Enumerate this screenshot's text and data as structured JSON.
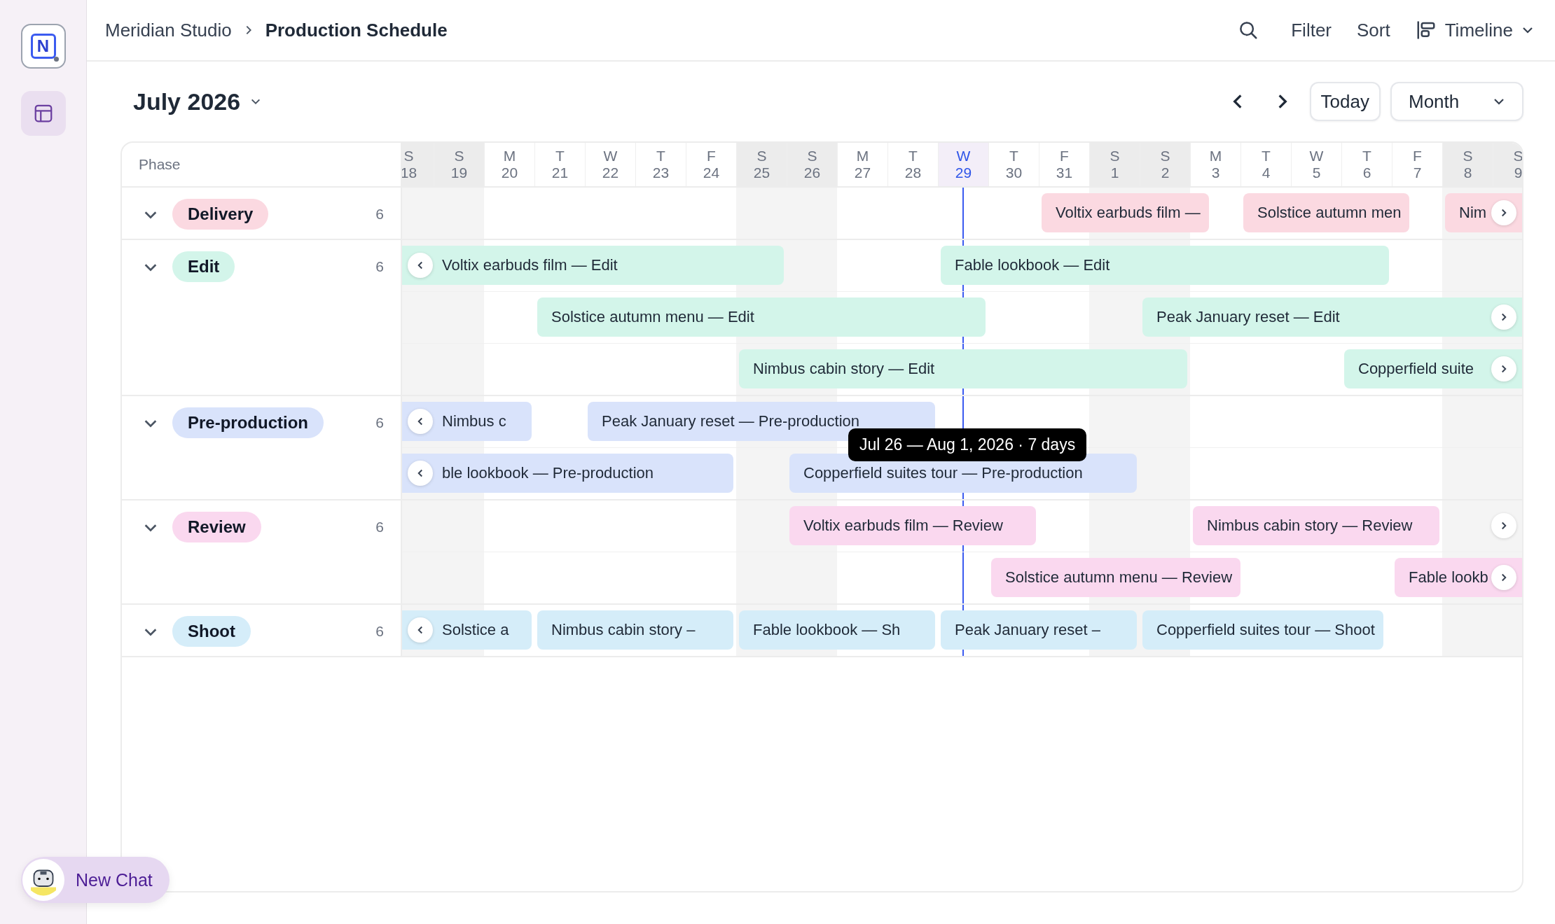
{
  "sidebar": {
    "logo": "N",
    "items": [
      {
        "selected": true
      }
    ]
  },
  "breadcrumb": [
    "Meridian Studio",
    "Production Schedule"
  ],
  "header_actions": [
    "Filter",
    "Sort"
  ],
  "view_menu": "Timeline",
  "calendar": {
    "month": "July 2026",
    "today_button": "Today",
    "range": "Month"
  },
  "timeline": {
    "column_header": "Phase",
    "days": [
      {
        "weekday": "S",
        "date": "18",
        "weekend": true,
        "today": false
      },
      {
        "weekday": "S",
        "date": "19",
        "weekend": true,
        "today": false
      },
      {
        "weekday": "M",
        "date": "20",
        "weekend": false,
        "today": false
      },
      {
        "weekday": "T",
        "date": "21",
        "weekend": false,
        "today": false
      },
      {
        "weekday": "W",
        "date": "22",
        "weekend": false,
        "today": false
      },
      {
        "weekday": "T",
        "date": "23",
        "weekend": false,
        "today": false
      },
      {
        "weekday": "F",
        "date": "24",
        "weekend": false,
        "today": false
      },
      {
        "weekday": "S",
        "date": "25",
        "weekend": true,
        "today": false
      },
      {
        "weekday": "S",
        "date": "26",
        "weekend": true,
        "today": false
      },
      {
        "weekday": "M",
        "date": "27",
        "weekend": false,
        "today": false
      },
      {
        "weekday": "T",
        "date": "28",
        "weekend": false,
        "today": false
      },
      {
        "weekday": "W",
        "date": "29",
        "weekend": false,
        "today": true
      },
      {
        "weekday": "T",
        "date": "30",
        "weekend": false,
        "today": false
      },
      {
        "weekday": "F",
        "date": "31",
        "weekend": false,
        "today": false
      },
      {
        "weekday": "S",
        "date": "1",
        "weekend": true,
        "today": false
      },
      {
        "weekday": "S",
        "date": "2",
        "weekend": true,
        "today": false
      },
      {
        "weekday": "M",
        "date": "3",
        "weekend": false,
        "today": false
      },
      {
        "weekday": "T",
        "date": "4",
        "weekend": false,
        "today": false
      },
      {
        "weekday": "W",
        "date": "5",
        "weekend": false,
        "today": false
      },
      {
        "weekday": "T",
        "date": "6",
        "weekend": false,
        "today": false
      },
      {
        "weekday": "F",
        "date": "7",
        "weekend": false,
        "today": false
      },
      {
        "weekday": "S",
        "date": "8",
        "weekend": true,
        "today": false
      },
      {
        "weekday": "S",
        "date": "9",
        "weekend": true,
        "today": false
      }
    ],
    "groups": [
      {
        "name": "Delivery",
        "color": "#fbd9e1",
        "count": "6",
        "expanded": true,
        "lanes": [
          {
            "more_before": false,
            "more_after": true,
            "bars": [
              {
                "label": "Voltix earbuds film —"
              },
              {
                "label": "Solstice autumn men"
              },
              {
                "label": "Nim"
              }
            ]
          }
        ]
      },
      {
        "name": "Edit",
        "color": "#d3f5ea",
        "count": "6",
        "expanded": true,
        "lanes": [
          {
            "more_before": true,
            "more_after": false,
            "bars": [
              {
                "label": "Voltix earbuds film — Edit"
              },
              {
                "label": "Fable lookbook — Edit"
              }
            ]
          },
          {
            "more_before": false,
            "more_after": true,
            "bars": [
              {
                "label": "Solstice autumn menu — Edit"
              },
              {
                "label": "Peak January reset — Edit"
              }
            ]
          },
          {
            "more_before": false,
            "more_after": true,
            "bars": [
              {
                "label": "Nimbus cabin story — Edit"
              },
              {
                "label": "Copperfield suite"
              }
            ]
          }
        ]
      },
      {
        "name": "Pre-production",
        "color": "#d9e3fb",
        "count": "6",
        "expanded": true,
        "lanes": [
          {
            "more_before": true,
            "more_after": false,
            "bars": [
              {
                "label": "Nimbus c"
              },
              {
                "label": "Peak January reset — Pre-production"
              }
            ]
          },
          {
            "more_before": true,
            "more_after": false,
            "bars": [
              {
                "label": "ble lookbook — Pre-production"
              },
              {
                "label": "Copperfield suites tour — Pre-production",
                "tooltip": "Jul 26 — Aug 1, 2026 · 7 days"
              }
            ]
          }
        ]
      },
      {
        "name": "Review",
        "color": "#fad8ef",
        "count": "6",
        "expanded": true,
        "lanes": [
          {
            "more_before": false,
            "more_after": true,
            "bars": [
              {
                "label": "Voltix earbuds film — Review"
              },
              {
                "label": "Nimbus cabin story — Review"
              }
            ]
          },
          {
            "more_before": false,
            "more_after": true,
            "bars": [
              {
                "label": "Solstice autumn menu — Review"
              },
              {
                "label": "Fable lookb"
              }
            ]
          }
        ]
      },
      {
        "name": "Shoot",
        "color": "#d5edf9",
        "count": "6",
        "expanded": true,
        "lanes": [
          {
            "more_before": true,
            "more_after": false,
            "bars": [
              {
                "label": "Solstice a"
              },
              {
                "label": "Nimbus cabin story –"
              },
              {
                "label": "Fable lookbook — Sh"
              },
              {
                "label": "Peak January reset –"
              },
              {
                "label": "Copperfield suites tour — Shoot"
              }
            ]
          }
        ]
      }
    ]
  },
  "chat_button": {
    "label": "New Chat"
  }
}
